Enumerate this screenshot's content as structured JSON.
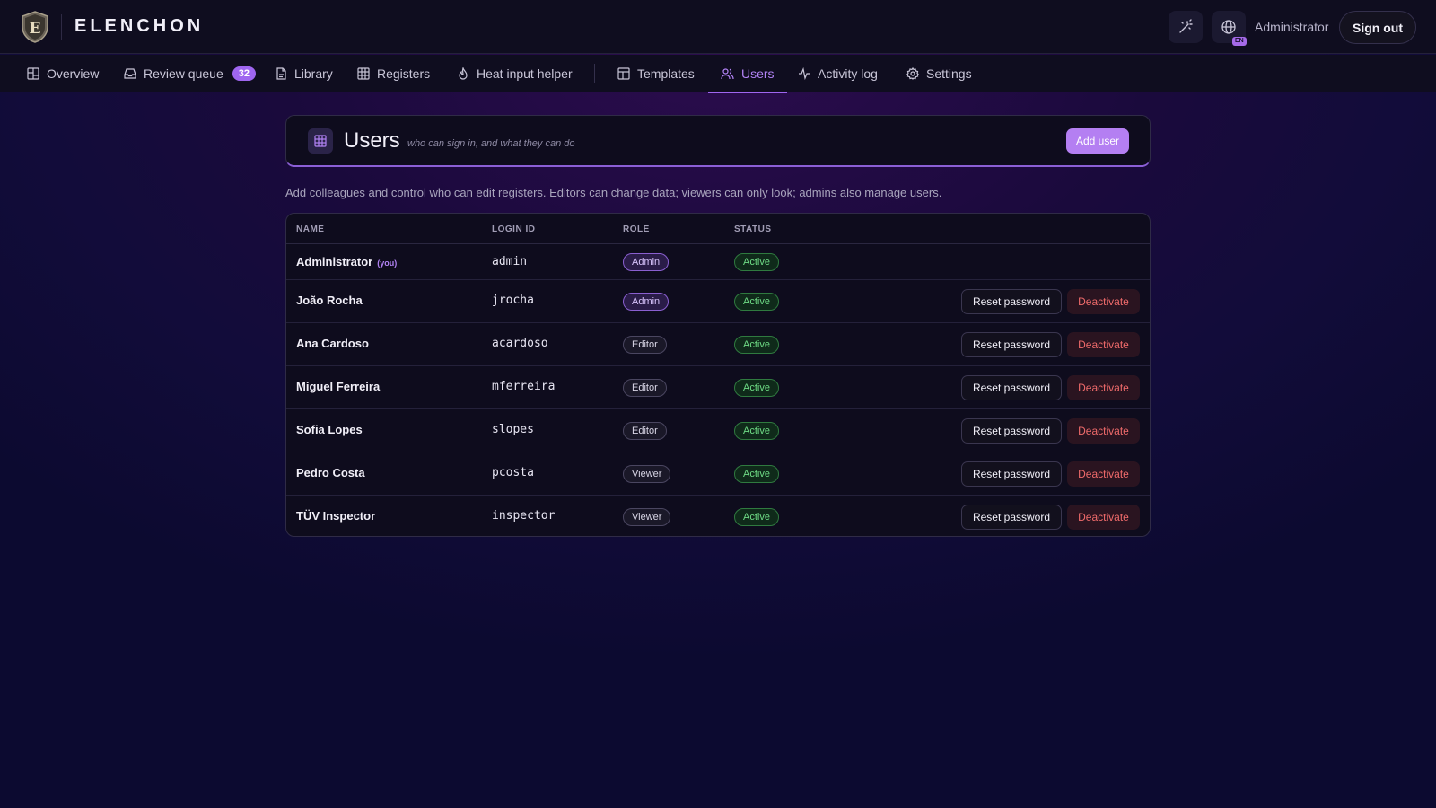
{
  "app": {
    "brand": "ELENCHON",
    "user_name": "Administrator",
    "sign_out": "Sign out",
    "lang_badge": "EN"
  },
  "nav": {
    "items": [
      {
        "label": "Overview",
        "icon": "grid-icon"
      },
      {
        "label": "Review queue",
        "icon": "inbox-icon",
        "badge": "32"
      },
      {
        "label": "Library",
        "icon": "file-icon"
      },
      {
        "label": "Registers",
        "icon": "table-icon"
      },
      {
        "label": "Heat input helper",
        "icon": "flame-icon"
      },
      {
        "label": "Templates",
        "icon": "template-icon"
      },
      {
        "label": "Users",
        "icon": "users-icon",
        "active": true
      },
      {
        "label": "Activity log",
        "icon": "activity-icon"
      },
      {
        "label": "Settings",
        "icon": "gear-icon"
      }
    ]
  },
  "header": {
    "title": "Users",
    "subtitle": "who can sign in, and what they can do",
    "add_user": "Add user"
  },
  "intro": "Add colleagues and control who can edit registers. Editors can change data; viewers can only look; admins also manage users.",
  "table": {
    "columns": [
      "NAME",
      "LOGIN ID",
      "ROLE",
      "STATUS"
    ],
    "you_tag": "(you)",
    "reset_label": "Reset password",
    "deactivate_label": "Deactivate",
    "rows": [
      {
        "name": "Administrator",
        "login": "admin",
        "role": "Admin",
        "status": "Active",
        "is_you": true
      },
      {
        "name": "João Rocha",
        "login": "jrocha",
        "role": "Admin",
        "status": "Active"
      },
      {
        "name": "Ana Cardoso",
        "login": "acardoso",
        "role": "Editor",
        "status": "Active"
      },
      {
        "name": "Miguel Ferreira",
        "login": "mferreira",
        "role": "Editor",
        "status": "Active"
      },
      {
        "name": "Sofia Lopes",
        "login": "slopes",
        "role": "Editor",
        "status": "Active"
      },
      {
        "name": "Pedro Costa",
        "login": "pcosta",
        "role": "Viewer",
        "status": "Active"
      },
      {
        "name": "TÜV Inspector",
        "login": "inspector",
        "role": "Viewer",
        "status": "Active"
      }
    ]
  },
  "colors": {
    "accent": "#9f66f0",
    "success": "#6fdc86",
    "danger": "#f06b6b"
  }
}
